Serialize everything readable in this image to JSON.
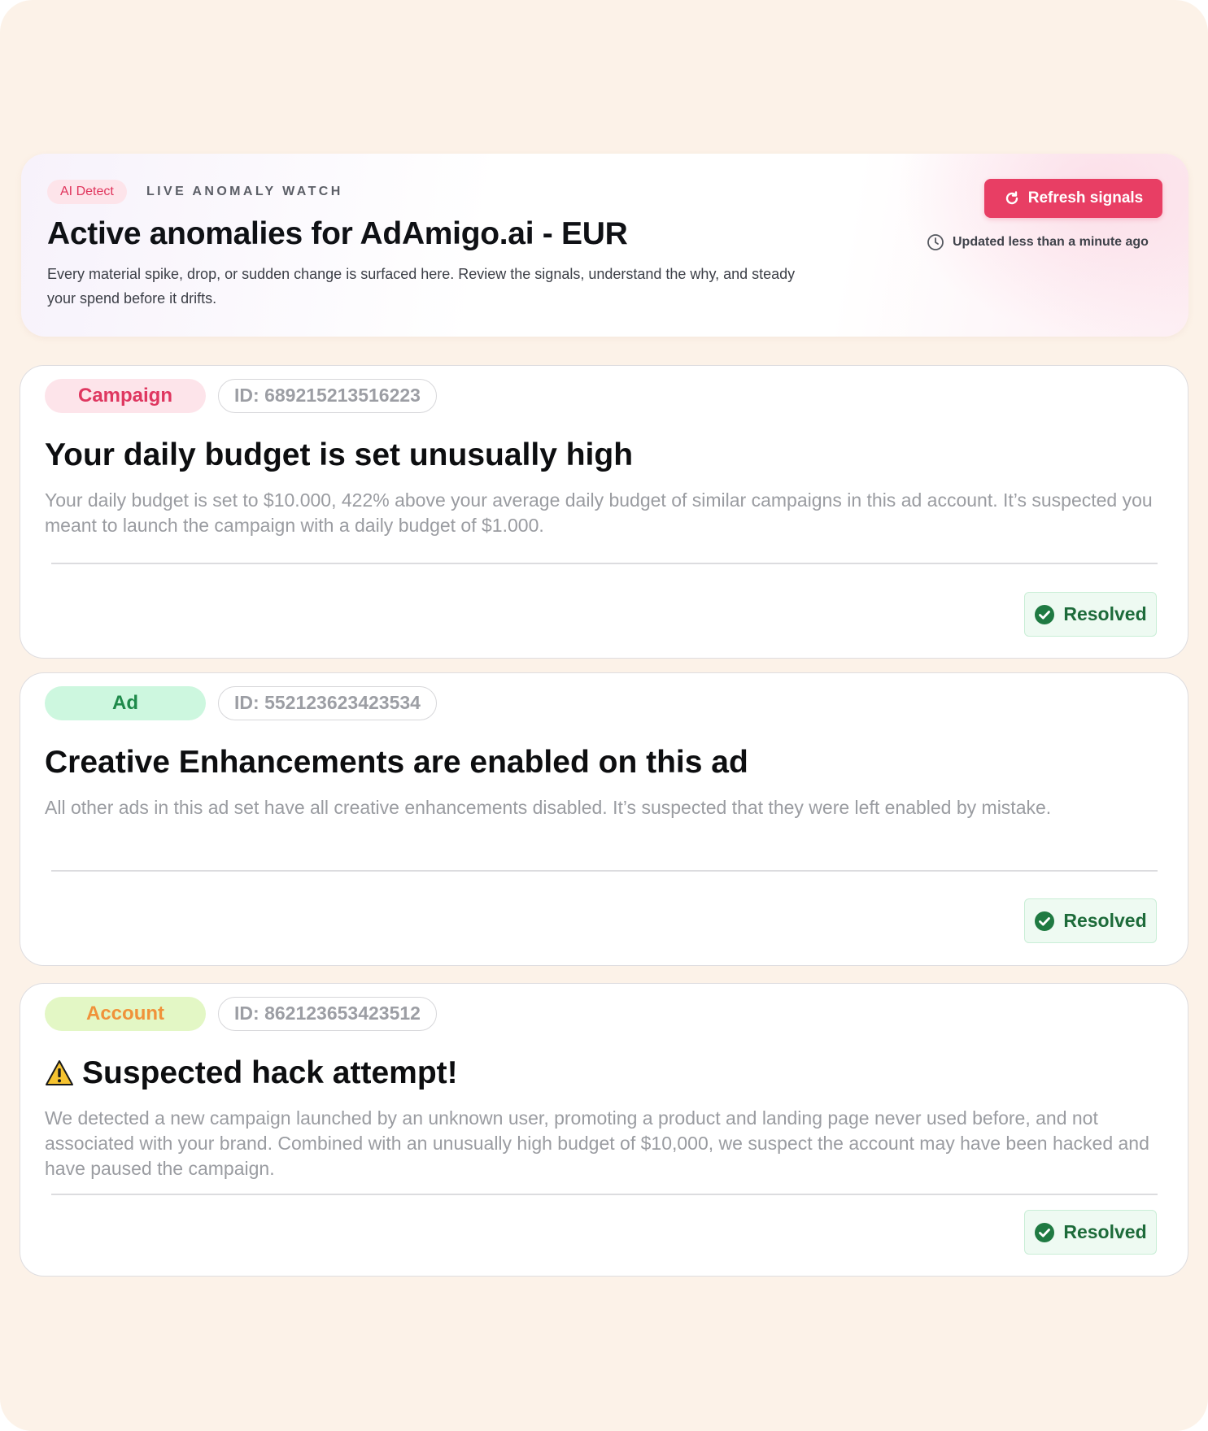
{
  "header": {
    "badge": "AI Detect",
    "eyebrow": "LIVE ANOMALY WATCH",
    "title": "Active anomalies for AdAmigo.ai - EUR",
    "description": "Every material spike, drop, or sudden change is surfaced here. Review the signals, understand the why, and steady your spend before it drifts.",
    "refresh_label": "Refresh signals",
    "refresh_icon": "refresh-icon",
    "updated_text": "Updated less than a minute ago",
    "updated_icon": "clock-icon"
  },
  "anomalies": [
    {
      "type": "Campaign",
      "id_text": "ID: 689215213516223",
      "title": "Your daily budget is set unusually high",
      "description": "Your daily budget is set to $10.000, 422% above your average daily budget of similar campaigns in this ad account. It’s suspected you meant to launch the campaign with a daily budget of $1.000.",
      "status": "Resolved"
    },
    {
      "type": "Ad",
      "id_text": "ID: 552123623423534",
      "title": "Creative Enhancements are enabled on this ad",
      "description": "All other ads in this ad set have all creative enhancements disabled. It’s suspected that they were left enabled by mistake.",
      "status": "Resolved"
    },
    {
      "type": "Account",
      "id_text": "ID: 862123653423512",
      "title": "Suspected hack attempt!",
      "title_icon": "warning-icon",
      "description": "We detected a new campaign launched by an unknown user, promoting a product and landing page never used before, and not associated with your brand. Combined with an unusually high budget of $10,000, we suspect the account may have been hacked and have paused the campaign.",
      "status": "Resolved"
    }
  ],
  "colors": {
    "background": "#fcf2e8",
    "accent": "#e83e64",
    "resolved_text": "#1d6b3a",
    "resolved_check": "#1f7a42"
  }
}
